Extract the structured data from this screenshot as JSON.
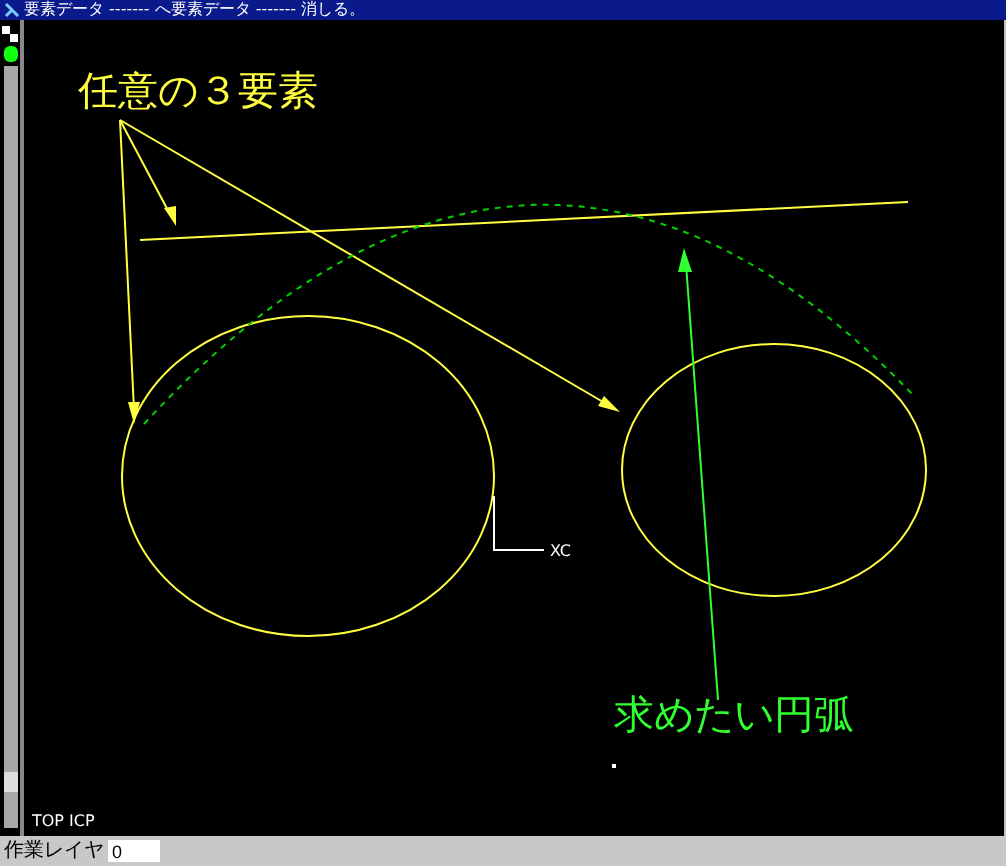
{
  "window": {
    "title": "要素データ ------- へ要素データ ------- 消しる。"
  },
  "canvas": {
    "annotation_yellow": "任意の３要素",
    "annotation_green": "求めたい円弧",
    "axis_label": "XC",
    "view_label": "TOP ICP"
  },
  "status_bar": {
    "label": "作業レイヤ",
    "value": "0"
  }
}
